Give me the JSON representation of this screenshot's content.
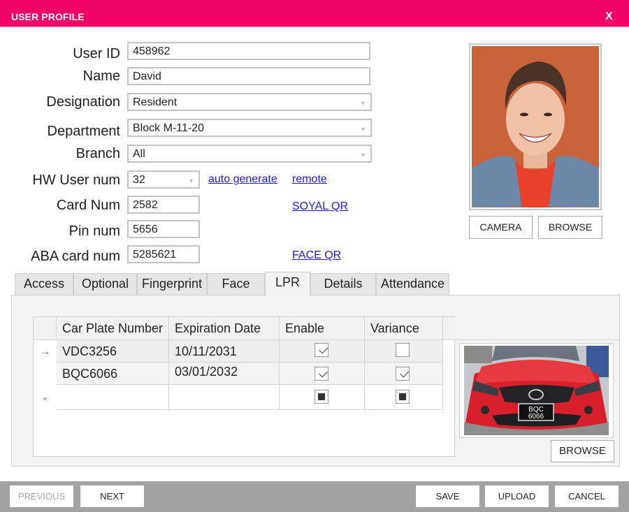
{
  "window": {
    "title": "USER PROFILE",
    "close_label": "X",
    "accent_color": "#f20366"
  },
  "form": {
    "user_id": {
      "label": "User ID",
      "value": "458962"
    },
    "name": {
      "label": "Name",
      "value": "David"
    },
    "designation": {
      "label": "Designation",
      "value": "Resident"
    },
    "department": {
      "label": "Department",
      "value": "Block M-11-20"
    },
    "branch": {
      "label": "Branch",
      "value": "All"
    },
    "hw_user_num": {
      "label": "HW User num",
      "value": "32"
    },
    "card_num": {
      "label": "Card Num",
      "value": "2582"
    },
    "pin_num": {
      "label": "Pin num",
      "value": "5656"
    },
    "aba_card_num": {
      "label": "ABA card num",
      "value": "5285621"
    }
  },
  "links": {
    "auto_generate": "auto generate",
    "remote": "remote",
    "soyal_qr": "SOYAL QR",
    "face_qr": "FACE QR"
  },
  "photo": {
    "alt": "User photo",
    "camera_label": "CAMERA",
    "browse_label": "BROWSE"
  },
  "tabs": [
    {
      "label": "Access",
      "active": false
    },
    {
      "label": "Optional",
      "active": false
    },
    {
      "label": "Fingerprint",
      "active": false
    },
    {
      "label": "Face",
      "active": false
    },
    {
      "label": "LPR",
      "active": true
    },
    {
      "label": "Details",
      "active": false
    },
    {
      "label": "Attendance",
      "active": false
    }
  ],
  "lpr": {
    "columns": [
      "Car Plate Number",
      "Expiration Date",
      "Enable",
      "Variance"
    ],
    "rows": [
      {
        "indicator": "→",
        "plate": "VDC3256",
        "expiration": "10/11/2031",
        "enable": "checked",
        "variance": "unchecked"
      },
      {
        "indicator": "",
        "plate": "BQC6066",
        "expiration": "03/01/2032",
        "enable": "checked",
        "variance": "checked"
      },
      {
        "indicator": "*",
        "plate": "",
        "expiration": "",
        "enable": "indeterminate",
        "variance": "indeterminate"
      }
    ],
    "car_image_plate_text": [
      "BQC",
      "6066"
    ],
    "browse_label": "BROWSE"
  },
  "footer": {
    "previous_label": "PREVIOUS",
    "next_label": "NEXT",
    "save_label": "SAVE",
    "upload_label": "UPLOAD",
    "cancel_label": "CANCEL"
  }
}
